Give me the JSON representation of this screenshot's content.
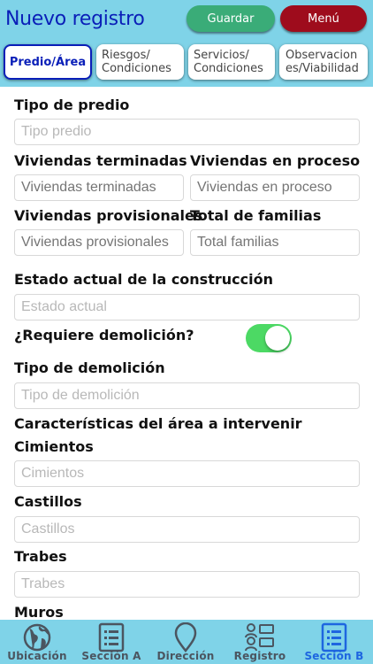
{
  "header": {
    "title": "Nuevo registro",
    "save_label": "Guardar",
    "menu_label": "Menú"
  },
  "tabs": [
    {
      "label": "Predio/Área"
    },
    {
      "label": "Riesgos/\nCondiciones"
    },
    {
      "label": "Servicios/\nCondiciones"
    },
    {
      "label": "Observacion\nes/Viabilidad"
    }
  ],
  "form": {
    "tipo_predio": {
      "label": "Tipo de predio",
      "placeholder": "Tipo predio"
    },
    "viviendas_terminadas": {
      "label": "Viviendas terminadas",
      "placeholder": "Viviendas terminadas"
    },
    "viviendas_proceso": {
      "label": "Viviendas en proceso",
      "placeholder": "Viviendas en proceso"
    },
    "viviendas_provisionales": {
      "label": "Viviendas provisionales",
      "placeholder": "Viviendas provisionales"
    },
    "total_familias": {
      "label": "Total de familias",
      "placeholder": "Total familias"
    },
    "estado_actual": {
      "label": "Estado actual de la construcción",
      "placeholder": "Estado actual"
    },
    "requiere_demolicion": {
      "label": "¿Requiere demolición?",
      "value": "on"
    },
    "tipo_demolicion": {
      "label": "Tipo de demolición",
      "placeholder": "Tipo de demolición"
    },
    "caracteristicas_heading": "Características del área a intervenir",
    "cimientos": {
      "label": "Cimientos",
      "placeholder": "Cimientos"
    },
    "castillos": {
      "label": "Castillos",
      "placeholder": "Castillos"
    },
    "trabes": {
      "label": "Trabes",
      "placeholder": "Trabes"
    },
    "muros": {
      "label": "Muros"
    }
  },
  "nav": [
    {
      "label": "Ubicación",
      "icon": "globe-icon"
    },
    {
      "label": "Sección A",
      "icon": "list-icon"
    },
    {
      "label": "Dirección",
      "icon": "map-pin-icon"
    },
    {
      "label": "Registro",
      "icon": "users-icon"
    },
    {
      "label": "Sección B",
      "icon": "list-icon",
      "active": true
    }
  ],
  "colors": {
    "header_bg": "#7fd3e8",
    "title": "#0a1fb8",
    "save": "#3aac78",
    "menu": "#9e0c1c",
    "toggle_on": "#4cd964",
    "nav_active": "#1e66e0"
  }
}
